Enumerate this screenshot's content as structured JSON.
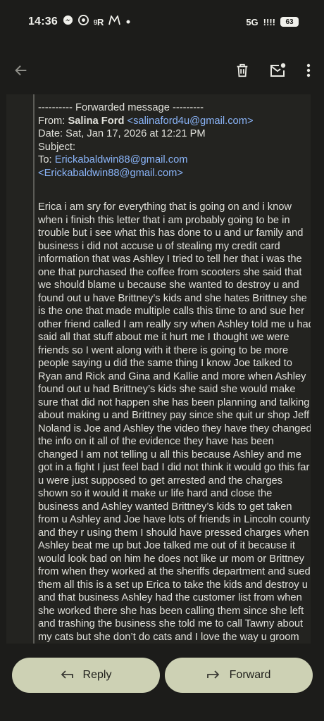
{
  "status_bar": {
    "time": "14:36",
    "network": "5G",
    "signal_glyph": "!!!!",
    "battery": "63",
    "icons": [
      "messenger-icon",
      "chrome-icon",
      "r-app-icon",
      "m-app-icon",
      "dot-icon"
    ]
  },
  "app_bar": {
    "icons": [
      "back-arrow-icon",
      "delete-icon",
      "mark-unread-icon",
      "more-icon"
    ]
  },
  "email": {
    "forward_header": "---------- Forwarded message ---------",
    "from_label": "From: ",
    "from_name": "Salina Ford",
    "from_email": "<salinaford4u@gmail.com>",
    "date_line": "Date: Sat, Jan 17, 2026 at 12:21 PM",
    "subject_line": "Subject:",
    "to_label": "To: ",
    "to_email": "Erickabaldwin88@gmail.com",
    "to_email_bracketed": "<Erickabaldwin88@gmail.com>",
    "body": "Erica i am sry for everything that is going on and i know when i finish this letter that i am probably going to be in trouble but i see what this has done to u and ur family and business i did not accuse u of stealing my credit card information that was Ashley I tried to tell her that i was the one that purchased the coffee from scooters she said that we should blame u because she wanted to destroy u and found out u have Brittney’s kids and she hates Brittney she is the one that made multiple calls this time to and sue her other friend called I am really sry when Ashley told me u had said all that stuff about me it hurt me I thought we were friends so I went along with it there is going to be more people saying u did the same thing I know Joe talked to Ryan and Rick and Gina and Kallie and more when Ashley found out u had Brittney’s kids she said she would make sure that did not happen she has been planning and talking about making u and Brittney pay since she quit ur shop Jeff Noland is Joe and Ashley the video they have they changed the info on it all of the evidence they have has been changed I am not telling u all this because Ashley and me got in a fight I just feel bad I did not think it would go this far u were just supposed to get arrested and the charges shown so it would it make ur life hard and close the business and Ashley wanted Brittney’s kids to get taken from u Ashley and Joe have lots of friends in Lincoln county and they r using them I should have pressed charges when Ashley beat me up but Joe talked me out of it because it would look bad on him he does not like ur mom or Brittney from when they worked at the sheriffs department and sued them all this is a set up Erica to take the kids and destroy u and that business Ashley had the customer list from when she worked there she has been calling them since she left and trashing the business she told me to call Tawny about my cats but she don’t do cats and I love the way u groom that is why I came to u Ashley said that would be perfect because I could pay over the phone and then say u stole my credit card information because she had already made It look like u did befor she also had pictures of peoples checks from when she worked their and she was using the information she told"
  },
  "actions": {
    "reply_label": "Reply",
    "forward_label": "Forward"
  },
  "colors": {
    "background": "#1c1c1a",
    "panel": "#232320",
    "link": "#8ab4f8",
    "pill": "#cdd1b4"
  }
}
